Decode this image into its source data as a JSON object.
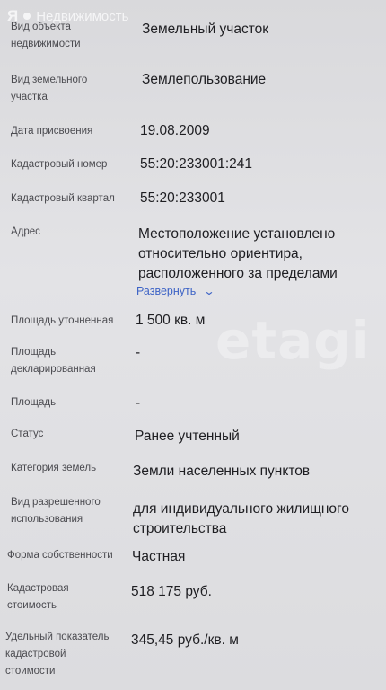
{
  "brand": {
    "logo": "Я",
    "name": "Недвижимость"
  },
  "watermark": "etagi",
  "fields": [
    {
      "label": "Вид объекта недвижимости",
      "value": "Земельный участок"
    },
    {
      "label": "Вид земельного участка",
      "value": "Землепользование"
    },
    {
      "label": "Дата присвоения",
      "value": "19.08.2009"
    },
    {
      "label": "Кадастровый номер",
      "value": "55:20:233001:241"
    },
    {
      "label": "Кадастровый квартал",
      "value": "55:20:233001"
    },
    {
      "label": "Адрес",
      "value": "Местоположение установлено относительно ориентира, расположенного за пределами"
    },
    {
      "label": "Площадь уточненная",
      "value": "1 500 кв. м"
    },
    {
      "label": "Площадь декларированная",
      "value": "-"
    },
    {
      "label": "Площадь",
      "value": "-"
    },
    {
      "label": "Статус",
      "value": "Ранее учтенный"
    },
    {
      "label": "Категория земель",
      "value": "Земли населенных пунктов"
    },
    {
      "label": "Вид разрешенного использования",
      "value": "для индивидуального жилищного строительства"
    },
    {
      "label": "Форма собственности",
      "value": "Частная"
    },
    {
      "label": "Кадастровая стоимость",
      "value": "518 175 руб."
    },
    {
      "label": "Удельный показатель кадастровой стоимости",
      "value": "345,45 руб./кв. м"
    }
  ],
  "address_expand": {
    "label": "Развернуть",
    "icon": "chevron-down-icon"
  }
}
